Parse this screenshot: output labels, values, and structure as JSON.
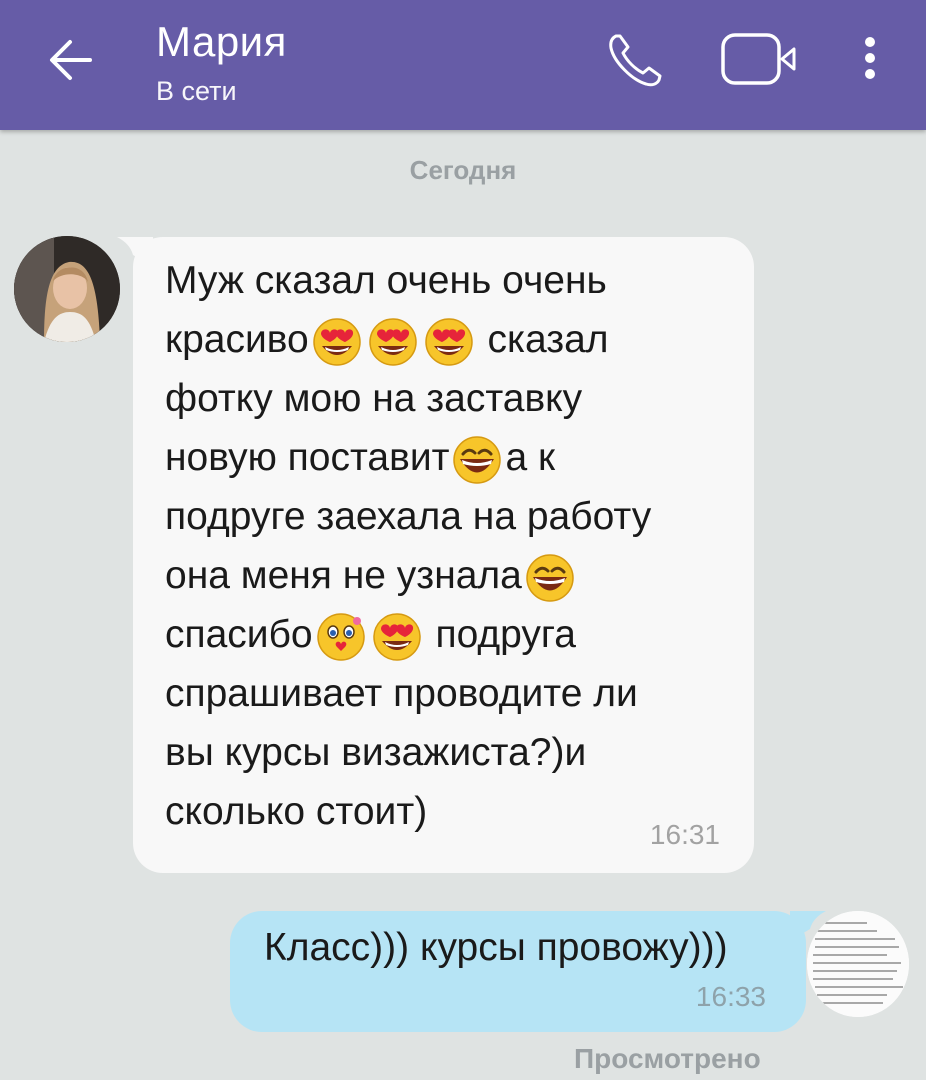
{
  "header": {
    "contact_name": "Мария",
    "contact_status": "В сети",
    "icons": [
      "back-arrow-icon",
      "phone-icon",
      "video-camera-icon",
      "more-vertical-icon"
    ],
    "bar_color": "#665ca7"
  },
  "chat": {
    "date_separator": "Сегодня",
    "incoming": {
      "lines": [
        {
          "parts": [
            {
              "t": "Муж сказал очень очень"
            }
          ]
        },
        {
          "parts": [
            {
              "t": "красиво"
            },
            {
              "e": "heart-eyes"
            },
            {
              "e": "heart-eyes"
            },
            {
              "e": "heart-eyes"
            },
            {
              "t": " сказал"
            }
          ]
        },
        {
          "parts": [
            {
              "t": "фотку мою на заставку"
            }
          ]
        },
        {
          "parts": [
            {
              "t": "новую поставит"
            },
            {
              "e": "laughing"
            },
            {
              "t": "а к"
            }
          ]
        },
        {
          "parts": [
            {
              "t": "подруге заехала на работу"
            }
          ]
        },
        {
          "parts": [
            {
              "t": "она меня не узнала"
            },
            {
              "e": "laughing"
            }
          ]
        },
        {
          "parts": [
            {
              "t": "спасибо"
            },
            {
              "e": "kiss"
            },
            {
              "e": "heart-eyes"
            },
            {
              "t": " подруга"
            }
          ]
        },
        {
          "parts": [
            {
              "t": "спрашивает проводите ли"
            }
          ]
        },
        {
          "parts": [
            {
              "t": "вы курсы визажиста?)и"
            }
          ]
        },
        {
          "parts": [
            {
              "t": "сколько стоит)"
            }
          ]
        }
      ],
      "time": "16:31",
      "bubble_color": "#f8f8f8"
    },
    "outgoing": {
      "text": "Класс))) курсы провожу)))",
      "time": "16:33",
      "bubble_color": "#b6e4f5",
      "status": "Просмотрено"
    }
  }
}
